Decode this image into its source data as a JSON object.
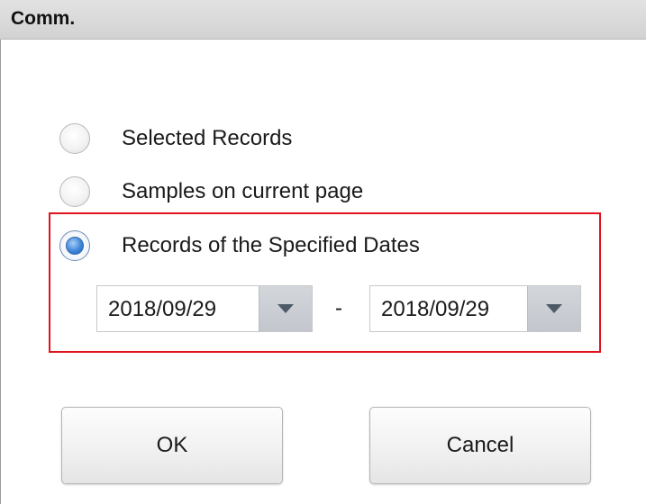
{
  "window": {
    "title": "Comm."
  },
  "options": [
    {
      "label": "Selected Records",
      "selected": false
    },
    {
      "label": "Samples on current page",
      "selected": false
    },
    {
      "label": "Records of the Specified Dates",
      "selected": true
    }
  ],
  "date_range": {
    "start": "2018/09/29",
    "separator": "-",
    "end": "2018/09/29",
    "dropdown_icon": "triangle-down-icon"
  },
  "buttons": {
    "ok_label": "OK",
    "cancel_label": "Cancel"
  },
  "colors": {
    "highlight_border": "#e0141f",
    "radio_selected": "#3f86d9",
    "titlebar": "#d9d9d9"
  }
}
